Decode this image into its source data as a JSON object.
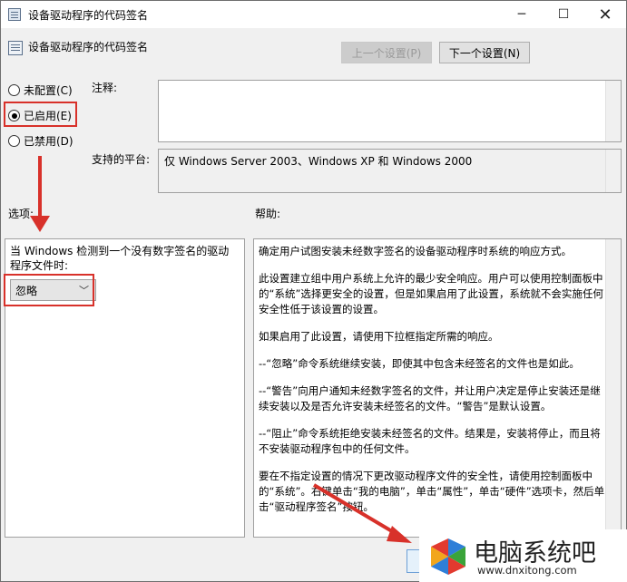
{
  "window": {
    "title": "设备驱动程序的代码签名",
    "controls": {
      "minimize": "─",
      "maximize": "☐",
      "close": "✕"
    }
  },
  "header": {
    "title": "设备驱动程序的代码签名",
    "prev_button": "上一个设置(P)",
    "next_button": "下一个设置(N)"
  },
  "state_options": [
    {
      "label": "未配置(C)",
      "selected": false
    },
    {
      "label": "已启用(E)",
      "selected": true
    },
    {
      "label": "已禁用(D)",
      "selected": false
    }
  ],
  "labels": {
    "comment": "注释:",
    "supported_platform": "支持的平台:",
    "options": "选项:",
    "help": "帮助:"
  },
  "supported_platform_value": "仅 Windows Server 2003、Windows XP 和 Windows 2000",
  "options_panel": {
    "description": "当 Windows 检测到一个没有数字签名的驱动程序文件时:",
    "dropdown_value": "忽略"
  },
  "help_paragraphs": [
    "确定用户试图安装未经数字签名的设备驱动程序时系统的响应方式。",
    "此设置建立组中用户系统上允许的最少安全响应。用户可以使用控制面板中的“系统”选择更安全的设置，但是如果启用了此设置，系统就不会实施任何安全性低于该设置的设置。",
    "如果启用了此设置，请使用下拉框指定所需的响应。",
    "--“忽略”命令系统继续安装，即使其中包含未经签名的文件也是如此。",
    "--“警告”向用户通知未经数字签名的文件，并让用户决定是停止安装还是继续安装以及是否允许安装未经签名的文件。“警告”是默认设置。",
    "--“阻止”命令系统拒绝安装未经签名的文件。结果是，安装将停止，而且将不安装驱动程序包中的任何文件。",
    "要在不指定设置的情况下更改驱动程序文件的安全性，请使用控制面板中的“系统”。右键单击“我的电脑”，单击“属性”，单击“硬件”选项卡，然后单击“驱动程序签名”按钮。"
  ],
  "watermark": {
    "brand": "电脑系统吧",
    "url": "www.dnxitong.com"
  },
  "colors": {
    "annotation_red": "#d8312a",
    "window_bg": "#f0f0f0"
  }
}
